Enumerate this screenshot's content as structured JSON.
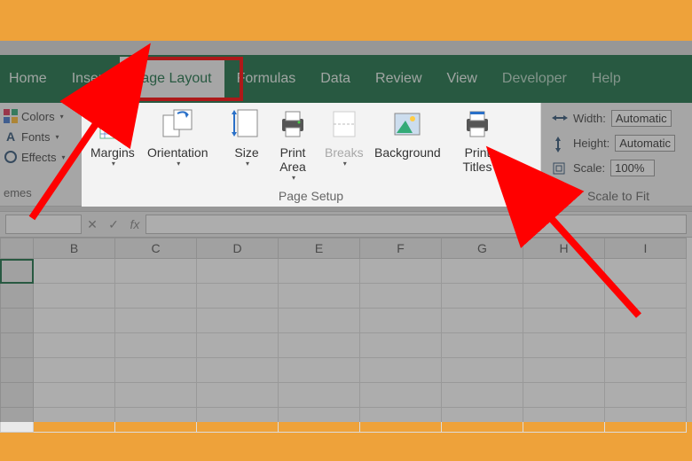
{
  "tabs": {
    "home": "Home",
    "insert": "Insert",
    "page_layout": "Page Layout",
    "formulas": "Formulas",
    "data": "Data",
    "review": "Review",
    "view": "View",
    "developer": "Developer",
    "help": "Help"
  },
  "themes": {
    "colors": "Colors",
    "fonts": "Fonts",
    "effects": "Effects",
    "label": "emes"
  },
  "page_setup": {
    "margins": "Margins",
    "orientation": "Orientation",
    "size": "Size",
    "print_area": "Print\nArea",
    "breaks": "Breaks",
    "background": "Background",
    "print_titles": "Print\nTitles",
    "group_label": "Page Setup"
  },
  "scale": {
    "width_label": "Width:",
    "height_label": "Height:",
    "scale_label": "Scale:",
    "width_value": "Automatic",
    "height_value": "Automatic",
    "scale_value": "100%",
    "group_label": "Scale to Fit"
  },
  "formula_bar": {
    "fx": "fx"
  },
  "columns": [
    "B",
    "C",
    "D",
    "E",
    "F",
    "G",
    "H",
    "I"
  ],
  "colors": {
    "accent": "#1a6f46",
    "highlight": "#ff0000",
    "frame": "#eea23a"
  }
}
